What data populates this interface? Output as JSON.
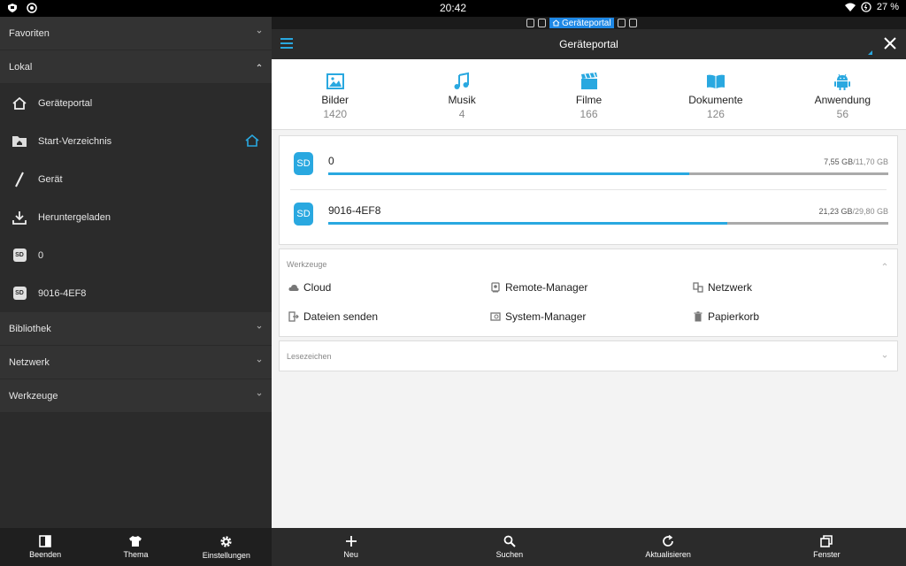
{
  "statusbar": {
    "time": "20:42",
    "battery": "27 %"
  },
  "sidebar": {
    "sections": [
      {
        "label": "Favoriten"
      },
      {
        "label": "Lokal"
      },
      {
        "label": "Bibliothek"
      },
      {
        "label": "Netzwerk"
      },
      {
        "label": "Werkzeuge"
      }
    ],
    "local_items": [
      {
        "label": "Geräteportal",
        "icon": "home-icon"
      },
      {
        "label": "Start-Verzeichnis",
        "icon": "folder-home-icon"
      },
      {
        "label": "Gerät",
        "icon": "slash-icon"
      },
      {
        "label": "Heruntergeladen",
        "icon": "download-icon"
      },
      {
        "label": "0",
        "icon": "sd-card-icon"
      },
      {
        "label": "9016-4EF8",
        "icon": "sd-card-icon"
      }
    ],
    "sd_badge": "SD",
    "bottom": [
      {
        "label": "Beenden",
        "icon": "exit-icon"
      },
      {
        "label": "Thema",
        "icon": "shirt-icon"
      },
      {
        "label": "Einstellungen",
        "icon": "gear-icon"
      }
    ]
  },
  "tabstrip": {
    "active_tab": "Geräteportal"
  },
  "topbar": {
    "title": "Geräteportal"
  },
  "categories": [
    {
      "label": "Bilder",
      "count": "1420",
      "icon": "image-icon"
    },
    {
      "label": "Musik",
      "count": "4",
      "icon": "music-icon"
    },
    {
      "label": "Filme",
      "count": "166",
      "icon": "film-icon"
    },
    {
      "label": "Dokumente",
      "count": "126",
      "icon": "book-icon"
    },
    {
      "label": "Anwendung",
      "count": "56",
      "icon": "android-icon"
    }
  ],
  "storage": [
    {
      "badge": "SD",
      "name": "0",
      "used": "7,55 GB",
      "total": "/11,70 GB",
      "fraction": 0.645
    },
    {
      "badge": "SD",
      "name": "9016-4EF8",
      "used": "21,23 GB",
      "total": "/29,80 GB",
      "fraction": 0.712
    }
  ],
  "tools": {
    "heading": "Werkzeuge",
    "items": [
      {
        "label": "Cloud",
        "icon": "cloud-icon"
      },
      {
        "label": "Remote-Manager",
        "icon": "remote-icon"
      },
      {
        "label": "Netzwerk",
        "icon": "network-icon"
      },
      {
        "label": "Dateien senden",
        "icon": "send-files-icon"
      },
      {
        "label": "System-Manager",
        "icon": "system-manager-icon"
      },
      {
        "label": "Papierkorb",
        "icon": "trash-icon"
      }
    ]
  },
  "bookmarks": {
    "heading": "Lesezeichen"
  },
  "main_bottom": [
    {
      "label": "Neu",
      "icon": "plus-icon"
    },
    {
      "label": "Suchen",
      "icon": "search-icon"
    },
    {
      "label": "Aktualisieren",
      "icon": "refresh-icon"
    },
    {
      "label": "Fenster",
      "icon": "windows-icon"
    }
  ],
  "colors": {
    "accent": "#29a8e0",
    "sidebar_bg": "#2b2b2b"
  }
}
